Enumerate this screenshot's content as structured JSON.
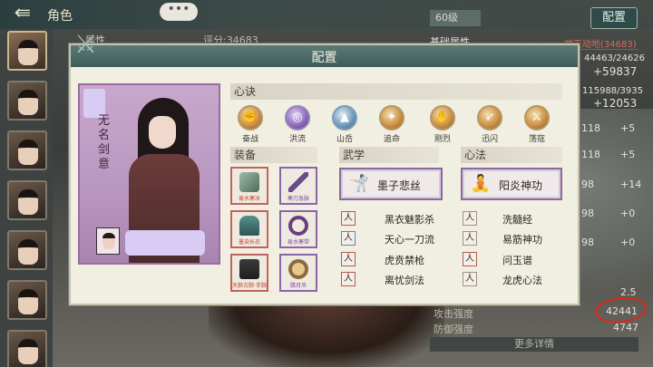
{
  "topbar": {
    "title": "角色",
    "back_icon": "back-arrow-icon",
    "chat_icon": "chat-bubble-icon",
    "chat_glyph": "•••"
  },
  "right_panel": {
    "level": "60级",
    "config_button": "配置",
    "section_title": "基础属性",
    "realm_label": "神王动地(34683)",
    "score_label": "评分:34683",
    "stat_rows": [
      {
        "a": "44463/24626",
        "b": "+59837"
      },
      {
        "a": "115988/3935",
        "b": "+12053"
      }
    ],
    "side_values": [
      {
        "left": "118",
        "right": "+5"
      },
      {
        "left": "118",
        "right": "+5"
      },
      {
        "left": "98",
        "right": "+14"
      },
      {
        "left": "98",
        "right": "+0"
      },
      {
        "left": "98",
        "right": "+0"
      }
    ],
    "value_25": "2.5",
    "attack_label": "攻击强度",
    "attack_value": "42441",
    "defense_label": "防御强度",
    "defense_value": "4747",
    "more_button": "更多详情",
    "header_partial": "属性"
  },
  "modal": {
    "title": "配置",
    "portrait": {
      "name": "无名剑意"
    },
    "xinjue": {
      "heading": "心诀",
      "skills": [
        {
          "label": "奋战",
          "glyph": "✊",
          "tone": "gold"
        },
        {
          "label": "洪流",
          "glyph": "◎",
          "tone": "purple"
        },
        {
          "label": "山岳",
          "glyph": "▲",
          "tone": "blue"
        },
        {
          "label": "追命",
          "glyph": "✦",
          "tone": "gold"
        },
        {
          "label": "刚烈",
          "glyph": "✋",
          "tone": "gold"
        },
        {
          "label": "迅闪",
          "glyph": "➶",
          "tone": "gold"
        },
        {
          "label": "荡寇",
          "glyph": "⚔",
          "tone": "gold"
        }
      ]
    },
    "equipment": {
      "heading": "装备",
      "items": [
        {
          "label": "易水寒冰",
          "tone": "red"
        },
        {
          "label": "寒刃急脉",
          "tone": "purple"
        },
        {
          "label": "墨染长衣",
          "tone": "red"
        },
        {
          "label": "易水寒带",
          "tone": "purple"
        },
        {
          "label": "天狼古腕·手腕",
          "tone": "red"
        },
        {
          "label": "腊月吊",
          "tone": "purple"
        }
      ]
    },
    "wuxue": {
      "heading": "武学",
      "primary": "墨子悲丝",
      "list": [
        "黑衣魅影杀",
        "天心一刀流",
        "虎贲禁枪",
        "离忧剑法"
      ]
    },
    "xinfa": {
      "heading": "心法",
      "primary": "阳炎神功",
      "list": [
        "洗髓经",
        "易筋神功",
        "问玉谱",
        "龙虎心法"
      ]
    }
  }
}
